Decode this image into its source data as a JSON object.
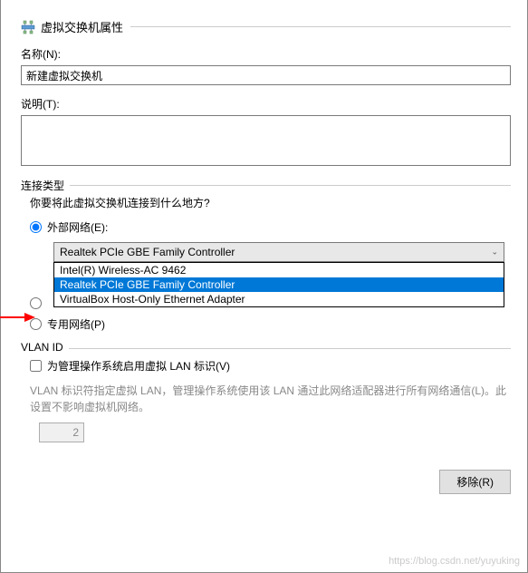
{
  "header": {
    "title": "虚拟交换机属性"
  },
  "name": {
    "label": "名称(N):",
    "value": "新建虚拟交换机"
  },
  "description": {
    "label": "说明(T):",
    "value": ""
  },
  "connectionType": {
    "groupLabel": "连接类型",
    "question": "你要将此虚拟交换机连接到什么地方?",
    "external": {
      "label": "外部网络(E):",
      "selected": "Realtek PCIe GBE Family Controller",
      "options": [
        "Intel(R) Wireless-AC 9462",
        "Realtek PCIe GBE Family Controller",
        "VirtualBox Host-Only Ethernet Adapter"
      ]
    },
    "private": {
      "label": "专用网络(P)"
    }
  },
  "vlan": {
    "groupLabel": "VLAN ID",
    "checkboxLabel": "为管理操作系统启用虚拟 LAN 标识(V)",
    "description": "VLAN 标识符指定虚拟 LAN，管理操作系统使用该 LAN 通过此网络适配器进行所有网络通信(L)。此设置不影响虚拟机网络。",
    "value": "2"
  },
  "buttons": {
    "remove": "移除(R)"
  },
  "watermark": "https://blog.csdn.net/yuyuking"
}
